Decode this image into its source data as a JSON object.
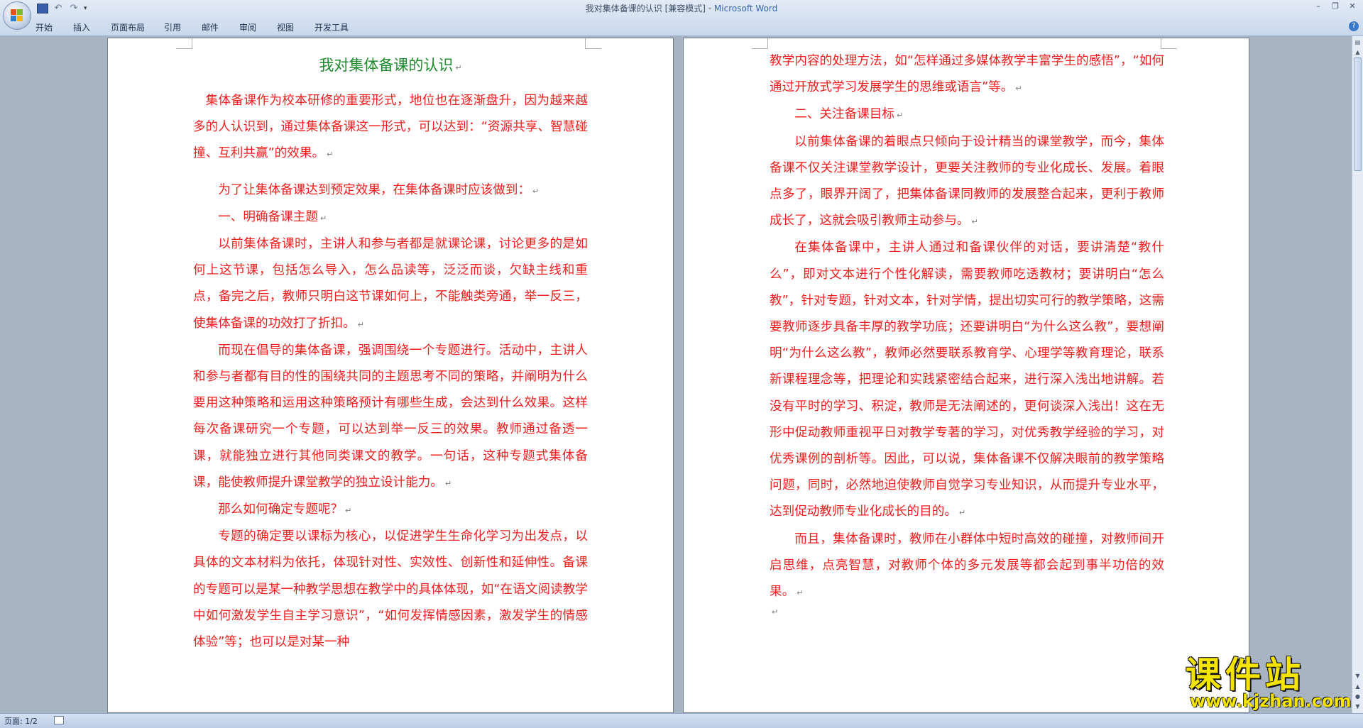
{
  "window": {
    "title": "我对集体备课的认识 [兼容模式] - ",
    "app_name": "Microsoft Word"
  },
  "ribbon": {
    "tabs": [
      "开始",
      "插入",
      "页面布局",
      "引用",
      "邮件",
      "审阅",
      "视图",
      "开发工具"
    ]
  },
  "page1": {
    "title": "我对集体备课的认识",
    "paragraphs": [
      "集体备课作为校本研修的重要形式，地位也在逐渐盘升，因为越来越多的人认识到，通过集体备课这一形式，可以达到：“资源共享、智慧碰撞、互利共赢”的效果。",
      "为了让集体备课达到预定效果，在集体备课时应该做到：",
      "一、明确备课主题",
      "以前集体备课时，主讲人和参与者都是就课论课，讨论更多的是如何上这节课，包括怎么导入，怎么品读等，泛泛而谈，欠缺主线和重点，备完之后，教师只明白这节课如何上，不能触类旁通，举一反三，使集体备课的功效打了折扣。",
      "而现在倡导的集体备课，强调围绕一个专题进行。活动中，主讲人和参与者都有目的性的围绕共同的主题思考不同的策略，并阐明为什么要用这种策略和运用这种策略预计有哪些生成，会达到什么效果。这样每次备课研究一个专题，可以达到举一反三的效果。教师通过备透一课，就能独立进行其他同类课文的教学。一句话，这种专题式集体备课，能使教师提升课堂教学的独立设计能力。",
      "那么如何确定专题呢？",
      "专题的确定要以课标为核心，以促进学生生命化学习为出发点，以具体的文本材料为依托，体现针对性、实效性、创新性和延伸性。备课的专题可以是某一种教学思想在教学中的具体体现，如“在语文阅读教学中如何激发学生自主学习意识”，“如何发挥情感因素，激发学生的情感体验”等；也可以是对某一种"
    ]
  },
  "page2": {
    "paragraphs": [
      "教学内容的处理方法，如“怎样通过多媒体教学丰富学生的感悟”，“如何通过开放式学习发展学生的思维或语言”等。",
      "二、关注备课目标",
      "以前集体备课的着眼点只倾向于设计精当的课堂教学，而今，集体备课不仅关注课堂教学设计，更要关注教师的专业化成长、发展。着眼点多了，眼界开阔了，把集体备课同教师的发展整合起来，更利于教师成长了，这就会吸引教师主动参与。",
      "在集体备课中，主讲人通过和备课伙伴的对话，要讲清楚“教什么”，即对文本进行个性化解读，需要教师吃透教材；要讲明白“怎么教”，针对专题，针对文本，针对学情，提出切实可行的教学策略，这需要教师逐步具备丰厚的教学功底；还要讲明白“为什么这么教”，要想阐明“为什么这么教”，教师必然要联系教育学、心理学等教育理论，联系新课程理念等，把理论和实践紧密结合起来，进行深入浅出地讲解。若没有平时的学习、积淀，教师是无法阐述的，更何谈深入浅出！这在无形中促动教师重视平日对教学专著的学习，对优秀教学经验的学习，对优秀课例的剖析等。因此，可以说，集体备课不仅解决眼前的教学策略问题，同时，必然地迫使教师自觉学习专业知识，从而提升专业水平，达到促动教师专业化成长的目的。",
      "而且，集体备课时，教师在小群体中短时高效的碰撞，对教师间开启思维，点亮智慧，对教师个体的多元发展等都会起到事半功倍的效果。"
    ]
  },
  "status": {
    "page_indicator": "页面: 1/2"
  },
  "watermark": {
    "brand": "课件站",
    "site": "www.kjzhan.com"
  },
  "colors": {
    "body_text": "#ef1f1f",
    "title_text": "#1d8a2b",
    "page_background": "#ffffff",
    "workspace": "#a9b4c3",
    "watermark": "#f5e400"
  },
  "icons": [
    "office-button-icon",
    "save-icon",
    "undo-icon",
    "redo-icon",
    "help-icon",
    "paragraph-mark-icon"
  ]
}
